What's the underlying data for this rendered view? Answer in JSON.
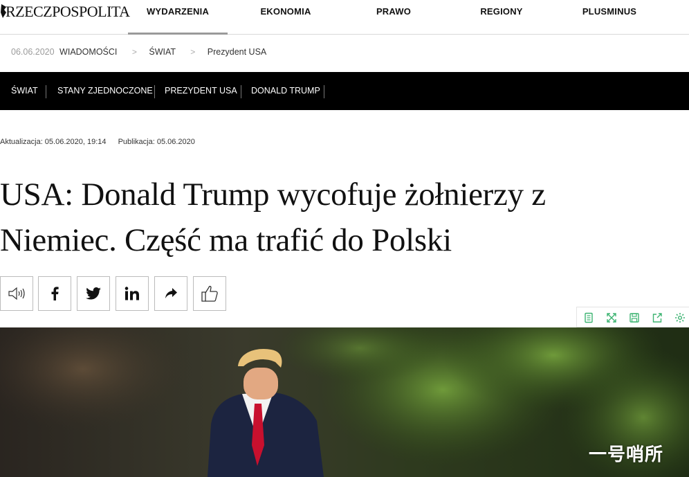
{
  "header": {
    "logo_text": "RZECZPOSPOLITA",
    "nav": [
      {
        "label": "WYDARZENIA",
        "active": true
      },
      {
        "label": "EKONOMIA",
        "active": false
      },
      {
        "label": "PRAWO",
        "active": false
      },
      {
        "label": "REGIONY",
        "active": false
      },
      {
        "label": "PLUSMINUS",
        "active": false
      }
    ]
  },
  "breadcrumb": {
    "date": "06.06.2020",
    "items": [
      "WIADOMOŚCI",
      "ŚWIAT",
      "Prezydent USA"
    ]
  },
  "tags": [
    "ŚWIAT",
    "STANY ZJEDNOCZONE",
    "PREZYDENT USA",
    "DONALD TRUMP"
  ],
  "article": {
    "updated": "Aktualizacja: 05.06.2020, 19:14",
    "published": "Publikacja: 05.06.2020",
    "title_line1": "USA: Donald Trump wycofuje żołnierzy z",
    "title_line2": "Niemiec. Część ma trafić do Polski"
  },
  "share_buttons": [
    "speaker-icon",
    "facebook-icon",
    "twitter-icon",
    "linkedin-icon",
    "share-arrow-icon",
    "thumbs-up-icon"
  ],
  "toolbar_icons": [
    "reader-icon",
    "expand-icon",
    "save-icon",
    "export-icon",
    "settings-icon"
  ],
  "watermark": "一号哨所",
  "colors": {
    "tagbar": "#000000",
    "toolbar_icon": "#3cb371",
    "accent_date": "#9b9b9b"
  }
}
